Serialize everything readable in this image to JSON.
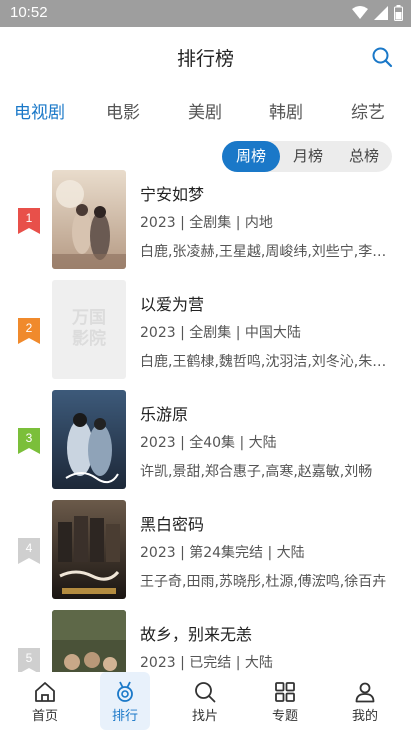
{
  "status": {
    "time": "10:52"
  },
  "header": {
    "title": "排行榜"
  },
  "categories": [
    "电视剧",
    "电影",
    "美剧",
    "韩剧",
    "综艺"
  ],
  "periods": [
    "周榜",
    "月榜",
    "总榜"
  ],
  "items": [
    {
      "rank": "1",
      "title": "宁安如梦",
      "meta": "2023 | 全剧集 | 内地",
      "cast": "白鹿,张凌赫,王星越,周峻纬,刘些宁,李沐宸",
      "rank_color": "#e8504a"
    },
    {
      "rank": "2",
      "title": "以爱为营",
      "meta": "2023 | 全剧集 | 中国大陆",
      "cast": "白鹿,王鹤棣,魏哲鸣,沈羽洁,刘冬沁,朱赞锦",
      "rank_color": "#f08a2c",
      "poster_placeholder": "万国影院"
    },
    {
      "rank": "3",
      "title": "乐游原",
      "meta": "2023 | 全40集 | 大陆",
      "cast": "许凯,景甜,郑合惠子,高寒,赵嘉敏,刘畅",
      "rank_color": "#7bbf3a"
    },
    {
      "rank": "4",
      "title": "黑白密码",
      "meta": "2023 | 第24集完结 | 大陆",
      "cast": "王子奇,田雨,苏晓彤,杜源,傅浤鸣,徐百卉",
      "rank_color": "#cfcfcf"
    },
    {
      "rank": "5",
      "title": "故乡，别来无恙",
      "meta": "2023 | 已完结 | 大陆",
      "cast": "",
      "rank_color": "#cfcfcf"
    }
  ],
  "nav": [
    "首页",
    "排行",
    "找片",
    "专题",
    "我的"
  ],
  "colors": {
    "accent": "#1a78c8",
    "statusbar": "#9e9e9e"
  }
}
